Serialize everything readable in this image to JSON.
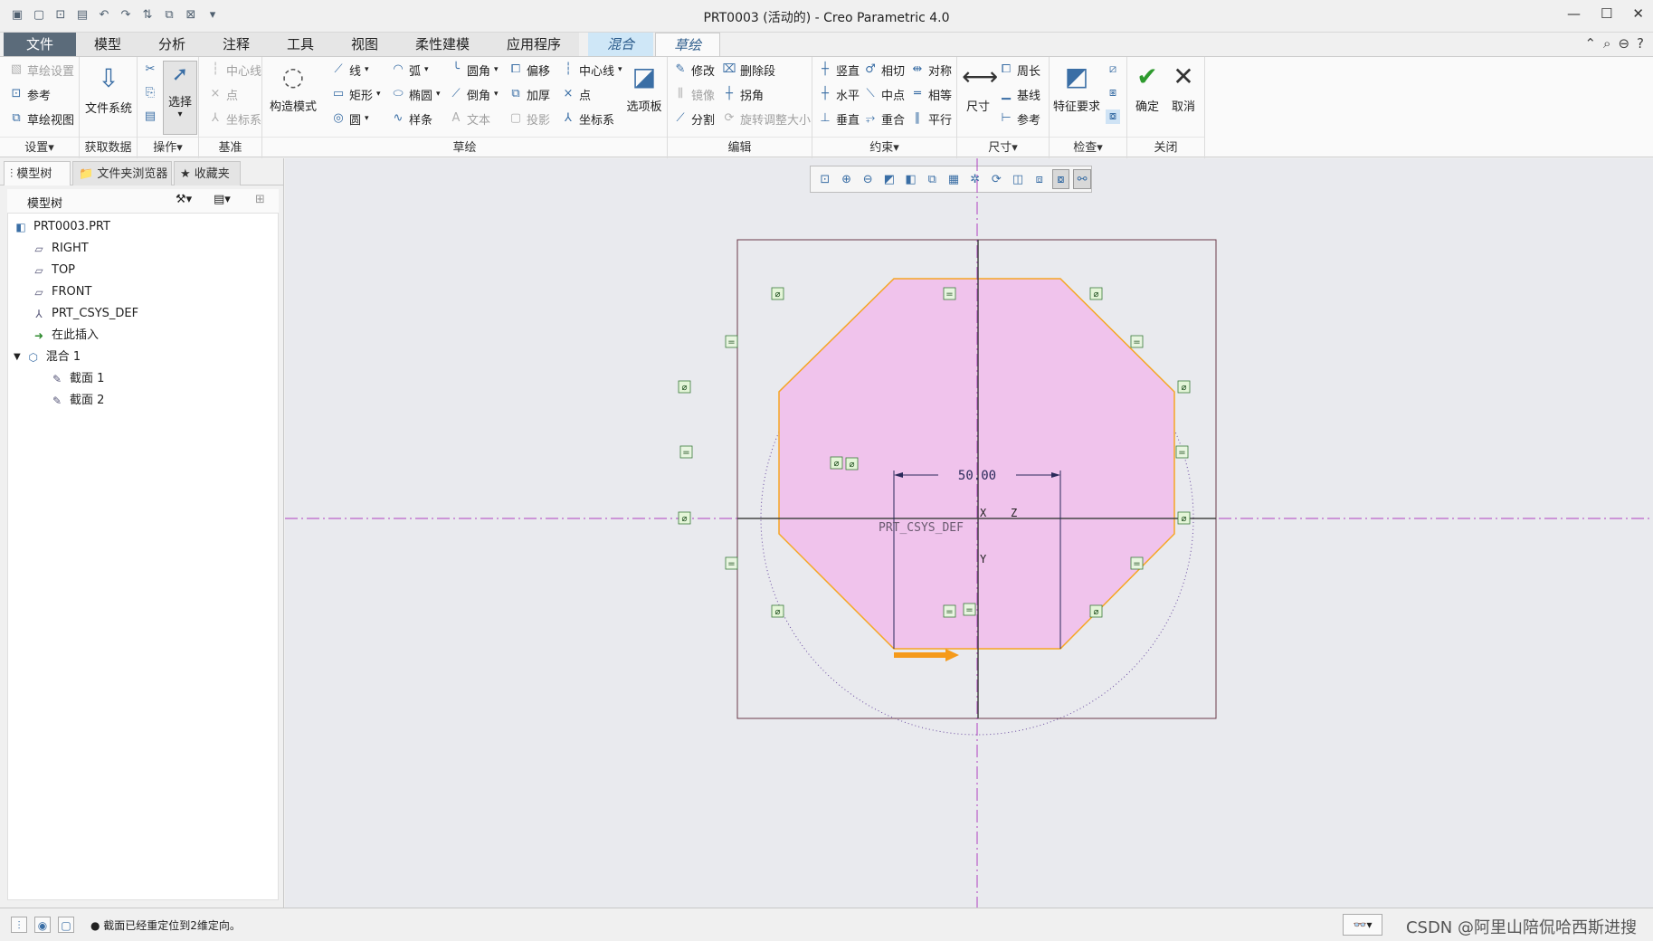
{
  "window": {
    "title": "PRT0003 (活动的) - Creo Parametric 4.0",
    "controls": [
      "—",
      "☐",
      "✕"
    ]
  },
  "quick_access": [
    "new-icon",
    "open-icon",
    "save-icon",
    "undo-icon",
    "redo-icon",
    "regenerate-icon",
    "windows-icon",
    "close-icon"
  ],
  "menu_tabs": {
    "file": "文件",
    "model": "模型",
    "analysis": "分析",
    "annotate": "注释",
    "tools": "工具",
    "view": "视图",
    "flexible": "柔性建模",
    "apps": "应用程序",
    "blend": "混合",
    "sketch": "草绘"
  },
  "ribbon": {
    "setup": {
      "label": "设置▾",
      "sketch_setup": "草绘设置",
      "references": "参考",
      "sketch_view": "草绘视图"
    },
    "get_data": {
      "label": "获取数据",
      "file_system": "文件系统"
    },
    "operations": {
      "label": "操作▾",
      "select": "选择"
    },
    "datum": {
      "label": "基准",
      "centerline": "中心线",
      "point": "点",
      "csys": "坐标系"
    },
    "sketching": {
      "label": "草绘",
      "construction_mode": "构造模式",
      "line": "线",
      "rectangle": "矩形",
      "circle": "圆",
      "arc": "弧",
      "ellipse": "椭圆",
      "spline": "样条",
      "fillet": "圆角",
      "chamfer": "倒角",
      "text": "文本",
      "offset": "偏移",
      "thicken": "加厚",
      "project": "投影",
      "centerline": "中心线",
      "point": "点",
      "csys": "坐标系",
      "palette": "选项板"
    },
    "editing": {
      "label": "编辑",
      "modify": "修改",
      "mirror": "镜像",
      "divide": "分割",
      "delete_segment": "删除段",
      "corner": "拐角",
      "rotate_resize": "旋转调整大小"
    },
    "constrain": {
      "label": "约束▾",
      "vertical": "竖直",
      "horizontal": "水平",
      "perpendicular": "垂直",
      "tangent": "相切",
      "midpoint": "中点",
      "coincident": "重合",
      "symmetric": "对称",
      "equal": "相等",
      "parallel": "平行"
    },
    "dimension": {
      "label": "尺寸▾",
      "dimension": "尺寸",
      "perimeter": "周长",
      "baseline": "基线",
      "reference": "参考"
    },
    "inspect": {
      "label": "检查▾",
      "feature_requirements": "特征要求"
    },
    "close": {
      "label": "关闭",
      "ok": "确定",
      "cancel": "取消"
    }
  },
  "panel": {
    "tabs": [
      "模型树",
      "文件夹浏览器",
      "收藏夹"
    ],
    "tree_header": "模型树",
    "tree": [
      {
        "label": "PRT0003.PRT",
        "icon": "part-icon"
      },
      {
        "label": "RIGHT",
        "icon": "datum-plane-icon"
      },
      {
        "label": "TOP",
        "icon": "datum-plane-icon"
      },
      {
        "label": "FRONT",
        "icon": "datum-plane-icon"
      },
      {
        "label": "PRT_CSYS_DEF",
        "icon": "csys-icon"
      },
      {
        "label": "在此插入",
        "icon": "insert-arrow-icon"
      },
      {
        "label": "混合 1",
        "icon": "blend-feature-icon"
      },
      {
        "label": "截面 1",
        "icon": "section-icon"
      },
      {
        "label": "截面 2",
        "icon": "section-icon"
      }
    ]
  },
  "graphics": {
    "dimension_value": "50.00",
    "csys_label": "PRT_CSYS_DEF",
    "axis_x": "X",
    "axis_z": "Z",
    "axis_y": "Y",
    "colors": {
      "fill": "#f0c3ec",
      "edge": "#f5a623",
      "centerline": "#b040c0",
      "background": "#e9eaee",
      "dim": "#2a2a5a"
    }
  },
  "status": {
    "message": "● 截面已经重定位到2维定向。",
    "watermark": "CSDN @阿里山陪侃哈西斯进搜"
  }
}
